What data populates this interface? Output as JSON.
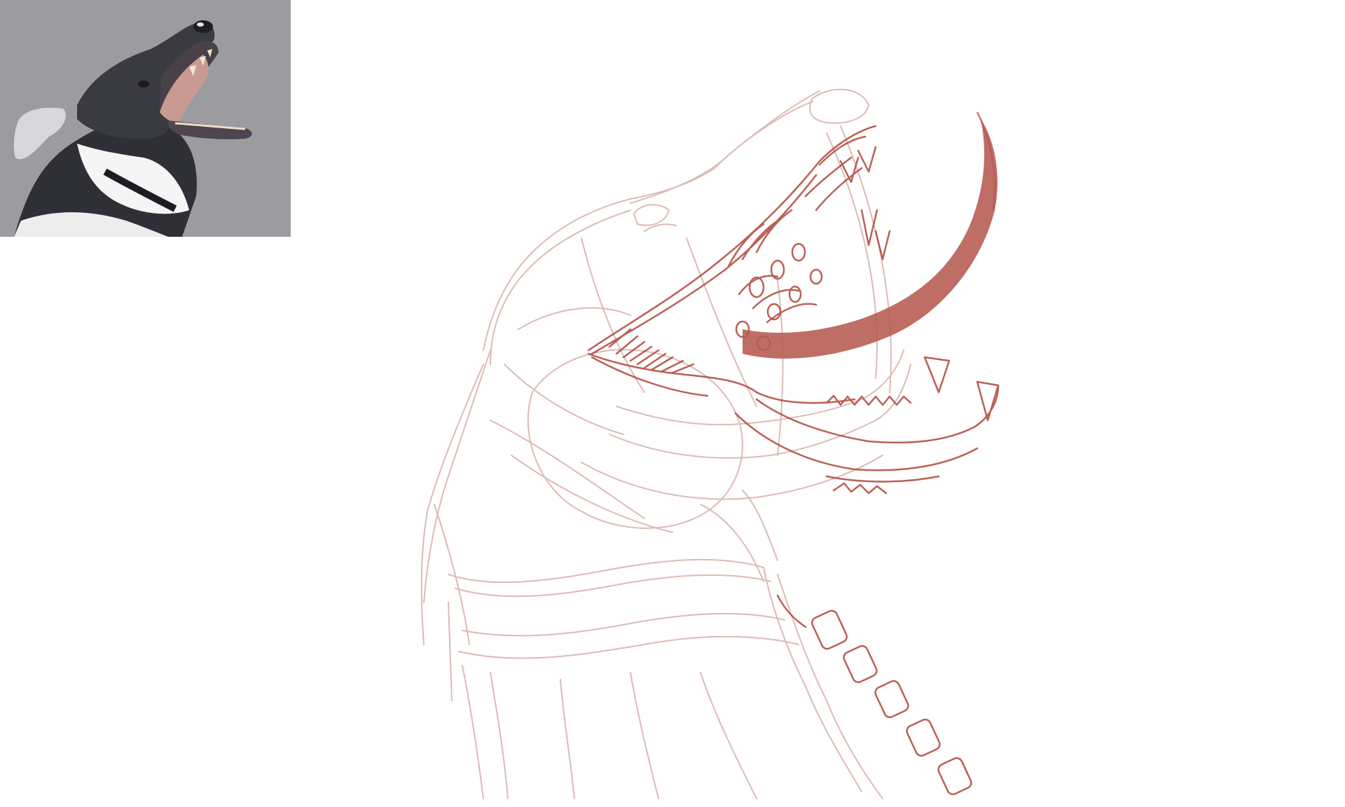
{
  "canvas": {
    "background": "#ffffff"
  },
  "reference_image": {
    "subject": "howling-dog-photo",
    "background_color": "#9c9ca0",
    "fur_dark": "#2a2a30",
    "fur_light": "#f4f4f4",
    "mouth_color": "#c99a92"
  },
  "sketch": {
    "subject": "howling-wolf-sketch",
    "construction_line_color": "#d9b3ad",
    "detail_line_color": "#b0453a",
    "tongue_color": "#b65a50"
  }
}
